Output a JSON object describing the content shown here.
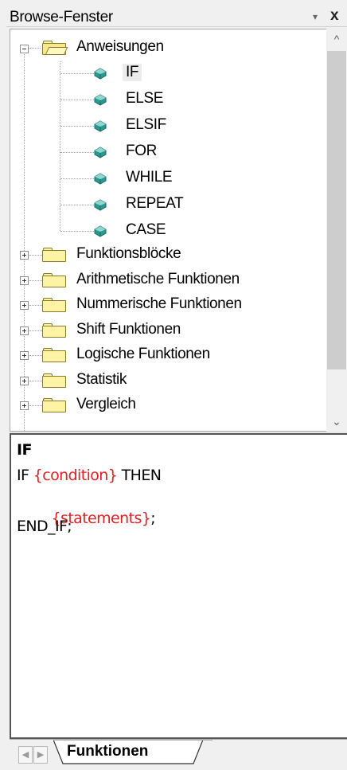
{
  "window": {
    "title": "Browse-Fenster",
    "pin_icon": "pin-icon",
    "close_label": "x"
  },
  "tree": {
    "root": {
      "label": "Anweisungen",
      "expanded": true,
      "icon": "open-folder-icon",
      "children": [
        {
          "label": "IF",
          "selected": true
        },
        {
          "label": "ELSE"
        },
        {
          "label": "ELSIF"
        },
        {
          "label": "FOR"
        },
        {
          "label": "WHILE"
        },
        {
          "label": "REPEAT"
        },
        {
          "label": "CASE"
        }
      ]
    },
    "folders": [
      {
        "label": "Funktionsblöcke"
      },
      {
        "label": "Arithmetische Funktionen"
      },
      {
        "label": "Nummerische Funktionen"
      },
      {
        "label": "Shift Funktionen"
      },
      {
        "label": "Logische Funktionen"
      },
      {
        "label": "Statistik"
      },
      {
        "label": "Vergleich"
      }
    ]
  },
  "code": {
    "header": "IF",
    "lines": [
      {
        "kw1": "IF ",
        "ph": "{condition}",
        "kw2": " THEN"
      },
      {
        "kw1": "  ",
        "ph": "{statements}",
        "kw2": ";"
      },
      {
        "kw1": "END_IF;",
        "ph": "",
        "kw2": ""
      }
    ]
  },
  "tabs": {
    "active": "Funktionen"
  },
  "colors": {
    "placeholder": "#e22020",
    "folder": "#fdf3a4",
    "gem": "#2a9a90"
  }
}
